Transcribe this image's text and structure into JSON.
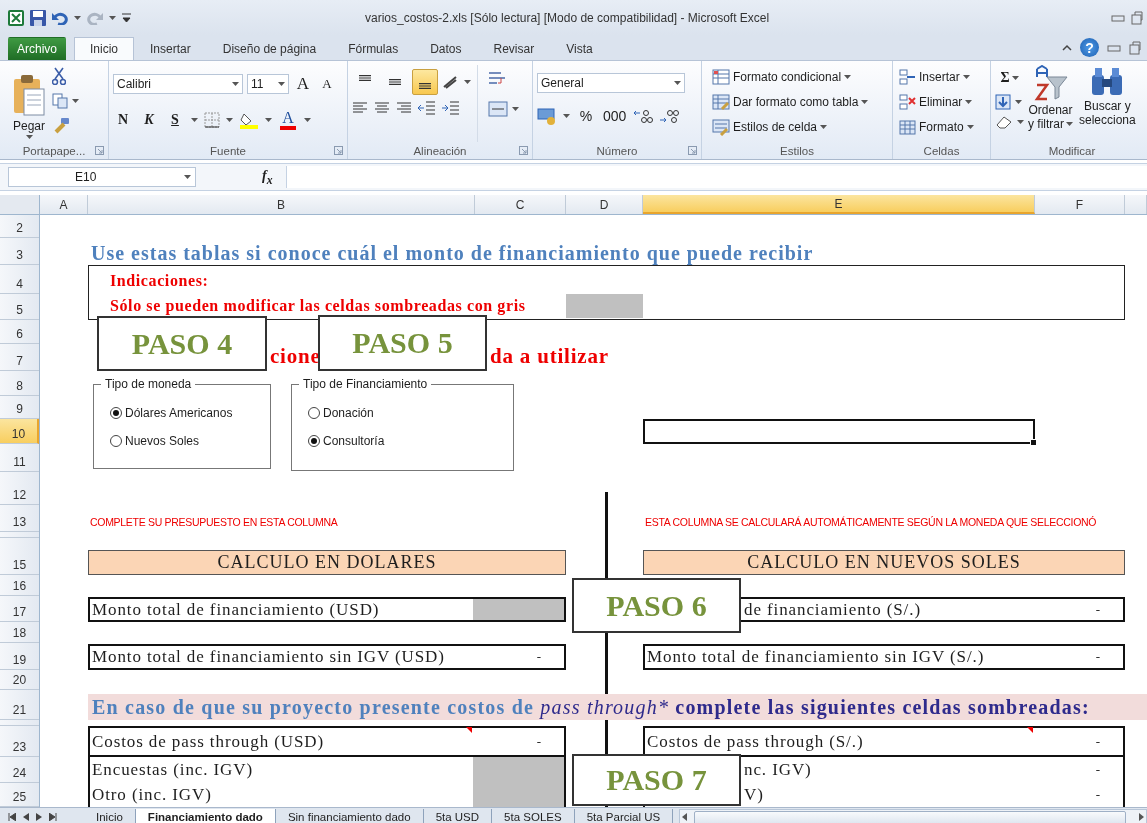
{
  "window": {
    "title": "varios_costos-2.xls  [Sólo lectura]  [Modo de compatibilidad]  -  Microsoft Excel"
  },
  "ribbon_tabs": [
    {
      "label": "Archivo",
      "kind": "file",
      "selected": false
    },
    {
      "label": "Inicio",
      "kind": "tab",
      "selected": true
    },
    {
      "label": "Insertar",
      "kind": "tab",
      "selected": false
    },
    {
      "label": "Diseño de página",
      "kind": "tab",
      "selected": false
    },
    {
      "label": "Fórmulas",
      "kind": "tab",
      "selected": false
    },
    {
      "label": "Datos",
      "kind": "tab",
      "selected": false
    },
    {
      "label": "Revisar",
      "kind": "tab",
      "selected": false
    },
    {
      "label": "Vista",
      "kind": "tab",
      "selected": false
    }
  ],
  "help": "?",
  "ribbon": {
    "clipboard": {
      "paste": "Pegar",
      "label": "Portapape..."
    },
    "font": {
      "name": "Calibri",
      "size": "11",
      "grow": "A",
      "shrink": "A",
      "bold": "N",
      "italic": "K",
      "underline": "S",
      "font_color": "A",
      "label": "Fuente"
    },
    "alignment": {
      "vertical": [
        {
          "selected": false
        },
        {
          "selected": false
        },
        {
          "selected": true
        }
      ],
      "label": "Alineación"
    },
    "number": {
      "format": "General",
      "percent": "%",
      "thousands": "000",
      "label": "Número"
    },
    "styles": {
      "items": [
        "Formato condicional",
        "Dar formato como tabla",
        "Estilos de celda"
      ],
      "label": "Estilos"
    },
    "cells": {
      "items": [
        "Insertar",
        "Eliminar",
        "Formato"
      ],
      "label": "Celdas"
    },
    "editing": {
      "sum": "Σ",
      "sort": [
        "Ordenar",
        "y filtrar"
      ],
      "find": [
        "Buscar y",
        "selecciona"
      ],
      "label": "Modificar"
    }
  },
  "formula_bar": {
    "name_box": "E10",
    "fx": "f$_{x}$"
  },
  "sheet": {
    "columns": [
      {
        "label": "A",
        "selected": false
      },
      {
        "label": "B",
        "selected": false
      },
      {
        "label": "C",
        "selected": false
      },
      {
        "label": "D",
        "selected": false
      },
      {
        "label": "E",
        "selected": true
      },
      {
        "label": "F",
        "selected": false
      }
    ],
    "rows": [
      {
        "label": "2",
        "selected": false
      },
      {
        "label": "3",
        "selected": false
      },
      {
        "label": "4",
        "selected": false
      },
      {
        "label": "5",
        "selected": false
      },
      {
        "label": "6",
        "selected": false
      },
      {
        "label": "7",
        "selected": false
      },
      {
        "label": "8",
        "selected": false
      },
      {
        "label": "9",
        "selected": false
      },
      {
        "label": "10",
        "selected": true
      },
      {
        "label": "11",
        "selected": false
      },
      {
        "label": "12",
        "selected": false
      },
      {
        "label": "13",
        "selected": false
      },
      {
        "label": "15",
        "selected": false
      },
      {
        "label": "16",
        "selected": false
      },
      {
        "label": "17",
        "selected": false
      },
      {
        "label": "18",
        "selected": false
      },
      {
        "label": "19",
        "selected": false
      },
      {
        "label": "20",
        "selected": false
      },
      {
        "label": "21",
        "selected": false
      },
      {
        "label": "23",
        "selected": false
      },
      {
        "label": "24",
        "selected": false
      },
      {
        "label": "25",
        "selected": false
      }
    ],
    "title": "Use estas tablas si conoce cuál el monto de financiamiento que puede recibir",
    "instructions": {
      "heading": "Indicaciones:",
      "text": "Sólo se pueden modificar las celdas sombreadas con gris"
    },
    "partial_heading": [
      "cione",
      "da a utilizar"
    ],
    "option_groups": [
      {
        "title": "Tipo de moneda",
        "options": [
          {
            "label": "Dólares Americanos",
            "selected": true
          },
          {
            "label": "Nuevos Soles",
            "selected": false
          }
        ]
      },
      {
        "title": "Tipo de Financiamiento",
        "options": [
          {
            "label": "Donación",
            "selected": false
          },
          {
            "label": "Consultoría",
            "selected": true
          }
        ]
      }
    ],
    "column_notes": [
      "COMPLETE SU PRESUPUESTO EN ESTA COLUMNA",
      "ESTA COLUMNA SE CALCULARÁ AUTOMÁTICAMENTE SEGÚN LA MONEDA QUE SELECCIONÓ"
    ],
    "tables": [
      {
        "header": "CALCULO EN DOLARES",
        "rows": [
          {
            "label": "Monto total de financiamiento (USD)",
            "kind": "input"
          },
          {
            "label": "Monto total de financiamiento sin IGV (USD)",
            "value": "-",
            "kind": "value"
          }
        ],
        "pass_through": [
          {
            "label": "Costos de pass through (USD)",
            "value": "-",
            "kind": "value",
            "comment": true
          },
          {
            "label": "Encuestas (inc. IGV)",
            "kind": "input",
            "comment": false
          },
          {
            "label": "Otro (inc. IGV)",
            "kind": "input",
            "comment": false
          }
        ]
      },
      {
        "header": "CALCULO EN NUEVOS SOLES",
        "rows": [
          {
            "label": "de financiamiento (S/.)",
            "value": "-",
            "kind": "value"
          },
          {
            "label": "Monto total de financiamiento sin IGV (S/.)",
            "value": "-",
            "kind": "value"
          }
        ],
        "pass_through": [
          {
            "label": "Costos de pass through (S/.)",
            "value": "-",
            "kind": "value",
            "comment": true
          },
          {
            "label": "nc. IGV)",
            "value": "-",
            "kind": "value",
            "comment": false
          },
          {
            "label": "V)",
            "value": "-",
            "kind": "value",
            "comment": false
          }
        ]
      }
    ],
    "pass_through_banner": [
      {
        "text": "En caso de que su proyecto presente costos de "
      },
      {
        "text": "pass through*"
      },
      {
        "text": " complete las siguientes celdas sombreadas:"
      }
    ],
    "steps": [
      "PASO 4",
      "PASO 5",
      "PASO 6",
      "PASO 7"
    ]
  },
  "sheet_tabs": [
    {
      "label": "Inicio",
      "selected": false
    },
    {
      "label": "Financiamiento dado",
      "selected": true
    },
    {
      "label": "Sin financiamiento dado",
      "selected": false
    },
    {
      "label": "5ta USD",
      "selected": false
    },
    {
      "label": "5ta SOLES",
      "selected": false
    },
    {
      "label": "5ta Parcial US",
      "selected": false
    }
  ]
}
